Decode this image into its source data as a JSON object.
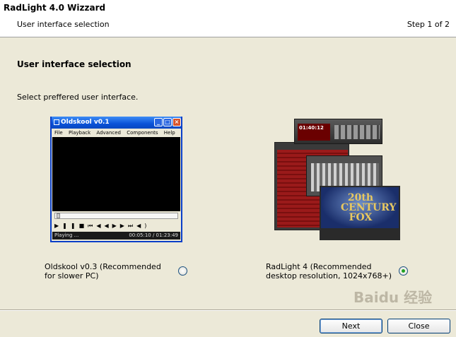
{
  "header": {
    "title": "RadLight 4.0 Wizzard",
    "subtitle": "User interface selection",
    "step": "Step 1 of 2"
  },
  "main": {
    "section_title": "User interface selection",
    "description": "Select preffered user interface.",
    "options": [
      {
        "label": "Oldskool v0.3 (Recommended for slower PC)",
        "selected": false,
        "preview": {
          "window_title": "Oldskool v0.1",
          "menu": [
            "File",
            "Playback",
            "Advanced",
            "Components",
            "Help"
          ],
          "status_text": "Playing ...",
          "time_text": "00:05:10 / 01:23:49"
        }
      },
      {
        "label": "RadLight 4 (Recommended desktop resolution, 1024x768+)",
        "selected": true,
        "preview": {
          "lcd_time": "01:40:12",
          "video_logo": "20th CENTURY FOX"
        }
      }
    ]
  },
  "buttons": {
    "next": "Next",
    "close": "Close"
  },
  "watermark": "Baidu 经验"
}
